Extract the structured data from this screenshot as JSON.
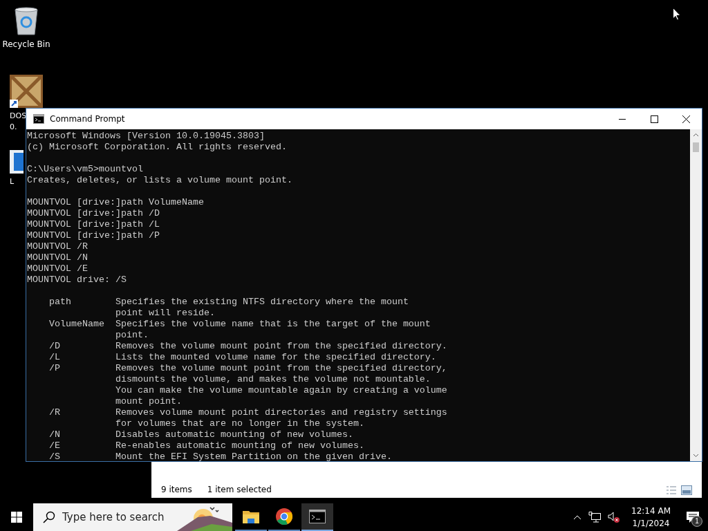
{
  "desktop_icons": [
    {
      "kind": "recycle",
      "label_lines": [
        "Recycle Bin"
      ]
    },
    {
      "kind": "dosbox",
      "label_lines": [
        "DOS",
        "0."
      ]
    },
    {
      "kind": "doc",
      "label_lines": [
        "L"
      ]
    }
  ],
  "explorer_window": {
    "status_bar": [
      "9 items",
      "1 item selected"
    ]
  },
  "console_window": {
    "title": "Command Prompt",
    "blocks": [
      [
        "Microsoft Windows [Version 10.0.19045.3803]",
        "(c) Microsoft Corporation. All rights reserved."
      ],
      [
        "C:\\Users\\vm5>mountvol",
        "Creates, deletes, or lists a volume mount point."
      ],
      [
        "MOUNTVOL [drive:]path VolumeName",
        "MOUNTVOL [drive:]path /D",
        "MOUNTVOL [drive:]path /L",
        "MOUNTVOL [drive:]path /P",
        "MOUNTVOL /R",
        "MOUNTVOL /N",
        "MOUNTVOL /E",
        "MOUNTVOL drive: /S"
      ],
      [
        "    path        Specifies the existing NTFS directory where the mount",
        "                point will reside.",
        "    VolumeName  Specifies the volume name that is the target of the mount",
        "                point.",
        "    /D          Removes the volume mount point from the specified directory.",
        "    /L          Lists the mounted volume name for the specified directory.",
        "    /P          Removes the volume mount point from the specified directory,",
        "                dismounts the volume, and makes the volume not mountable.",
        "                You can make the volume mountable again by creating a volume",
        "                mount point.",
        "    /R          Removes volume mount point directories and registry settings",
        "                for volumes that are no longer in the system.",
        "    /N          Disables automatic mounting of new volumes.",
        "    /E          Re-enables automatic mounting of new volumes.",
        "    /S          Mount the EFI System Partition on the given drive."
      ]
    ]
  },
  "taskbar": {
    "search": {
      "placeholder": "Type here to search"
    },
    "apps": [
      {
        "kind": "folder",
        "selected": false
      },
      {
        "kind": "chrome",
        "selected": false
      },
      {
        "kind": "console",
        "selected": true
      }
    ],
    "clock": {
      "time": "12:14 AM",
      "date": "1/1/2024"
    },
    "notification_count": "1"
  }
}
